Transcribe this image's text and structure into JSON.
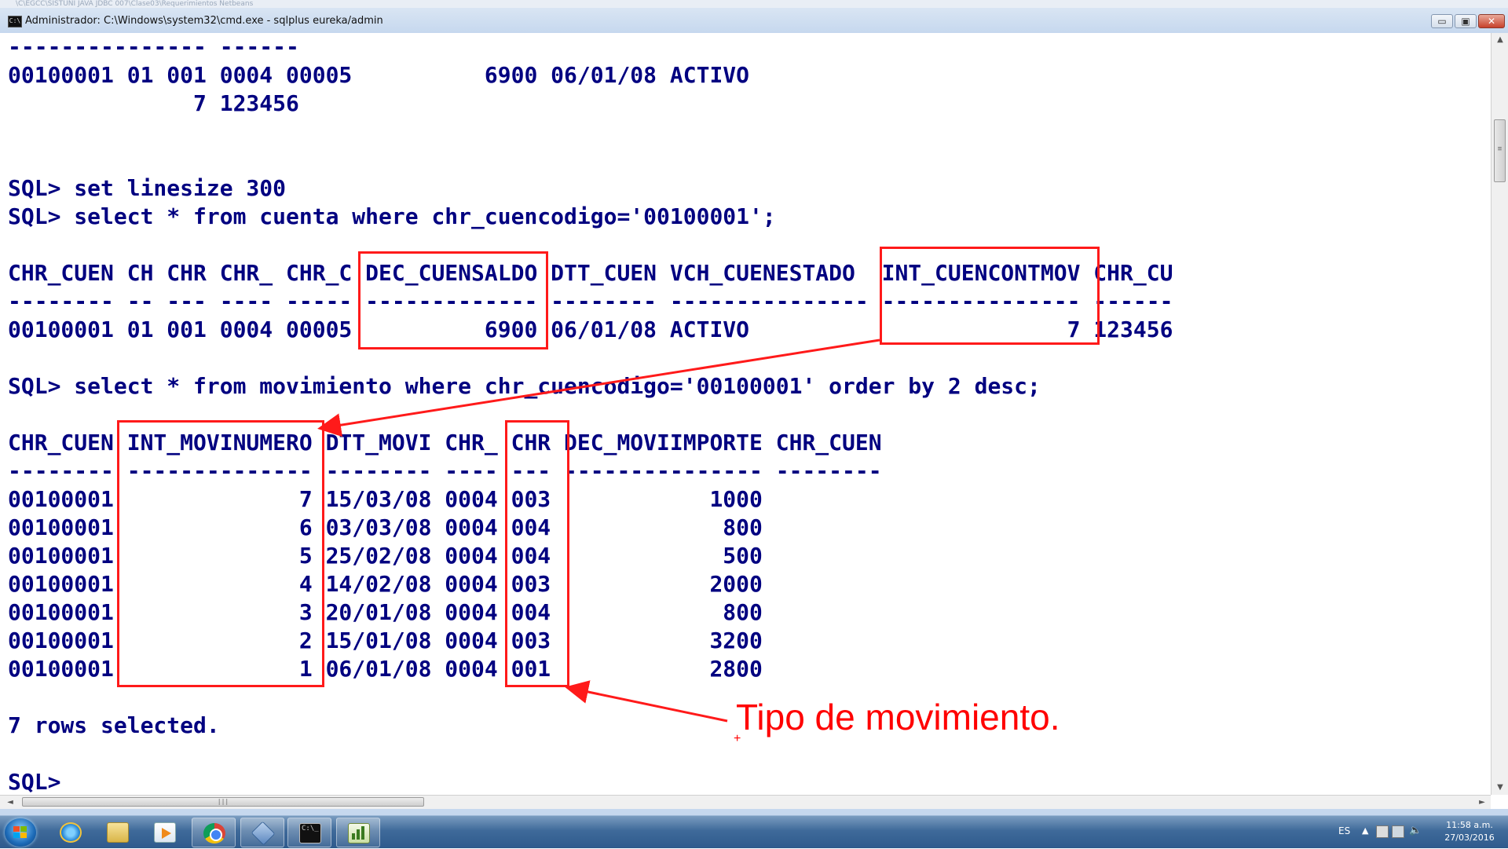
{
  "window": {
    "background_title": "\\C\\EGCC\\SISTUNI JAVA JDBC 007\\Clase03\\Requerimientos Netbeans",
    "title": "Administrador: C:\\Windows\\system32\\cmd.exe - sqlplus  eureka/admin",
    "minimize_label": "▭",
    "maximize_label": "▣",
    "close_label": "✕"
  },
  "console": {
    "lines": [
      "--------------- ------",
      "00100001 01 001 0004 00005          6900 06/01/08 ACTIVO",
      "              7 123456",
      "",
      "",
      "SQL> set linesize 300",
      "SQL> select * from cuenta where chr_cuencodigo='00100001';",
      "",
      "CHR_CUEN CH CHR CHR_ CHR_C DEC_CUENSALDO DTT_CUEN VCH_CUENESTADO  INT_CUENCONTMOV CHR_CU",
      "-------- -- --- ---- ----- ------------- -------- --------------- --------------- ------",
      "00100001 01 001 0004 00005          6900 06/01/08 ACTIVO                        7 123456",
      "",
      "SQL> select * from movimiento where chr_cuencodigo='00100001' order by 2 desc;",
      "",
      "CHR_CUEN INT_MOVINUMERO DTT_MOVI CHR_ CHR DEC_MOVIIMPORTE CHR_CUEN",
      "-------- -------------- -------- ---- --- --------------- --------",
      "00100001              7 15/03/08 0004 003            1000",
      "00100001              6 03/03/08 0004 004             800",
      "00100001              5 25/02/08 0004 004             500",
      "00100001              4 14/02/08 0004 003            2000",
      "00100001              3 20/01/08 0004 004             800",
      "00100001              2 15/01/08 0004 003            3200",
      "00100001              1 06/01/08 0004 001            2800",
      "",
      "7 rows selected.",
      "",
      "SQL>"
    ]
  },
  "annotation": {
    "label": "Tipo de movimiento.",
    "cross": "+",
    "color": "#ff0000"
  },
  "scrollbars": {
    "up": "▲",
    "down": "▼",
    "left": "◄",
    "right": "►",
    "grip": "≡",
    "hgrip": "|||"
  },
  "taskbar": {
    "apps": [
      "start-button",
      "internet-explorer",
      "file-explorer",
      "media-player",
      "chrome",
      "virtualbox",
      "cmd",
      "notepad-chart"
    ],
    "language": "ES",
    "time": "11:58 a.m.",
    "date": "27/03/2016"
  }
}
